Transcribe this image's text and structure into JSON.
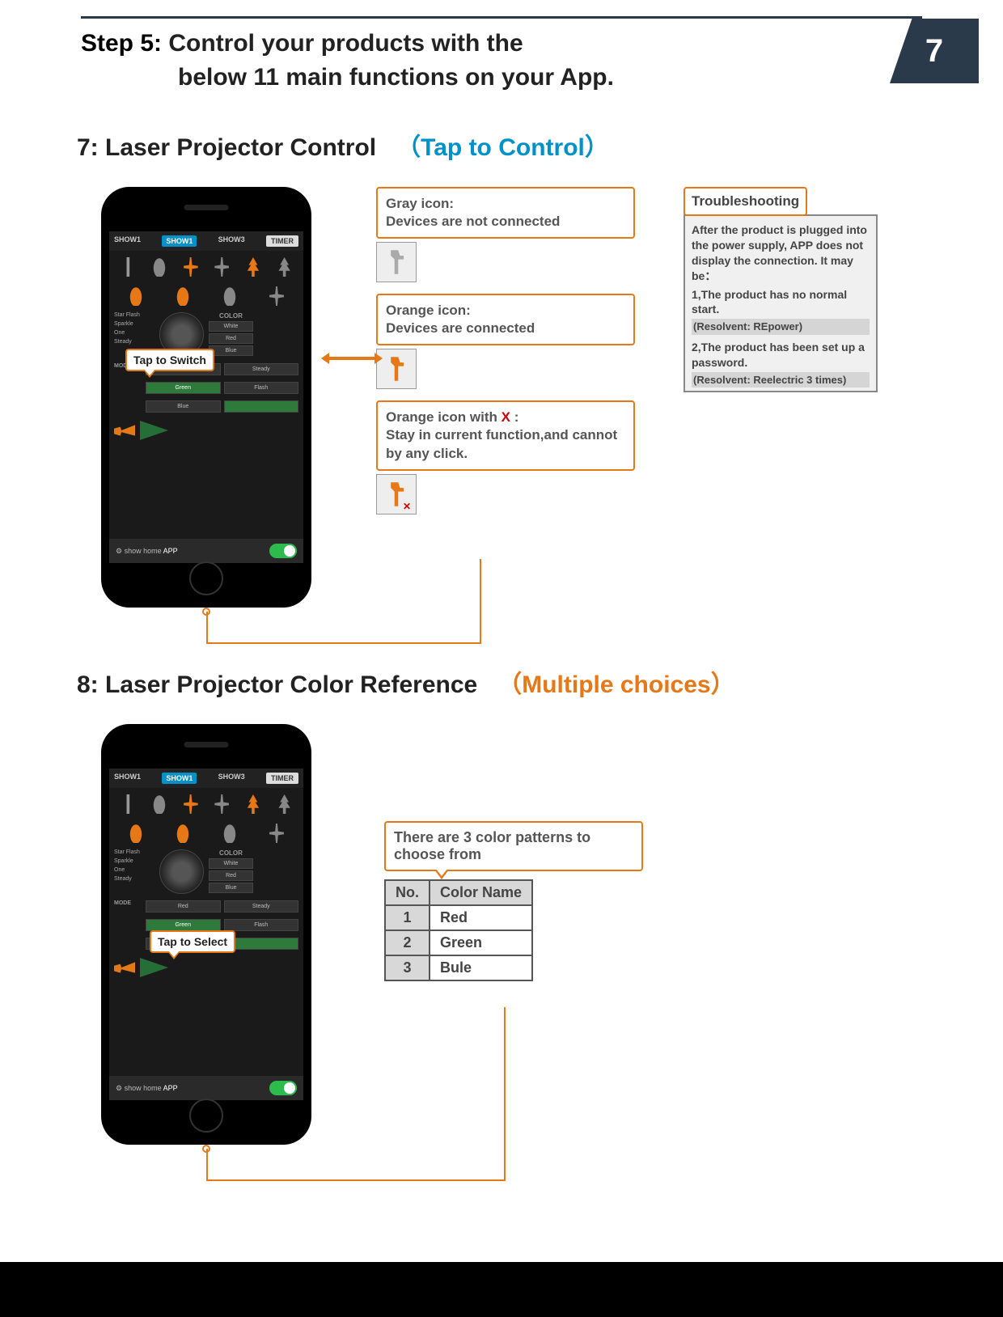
{
  "header": {
    "step_label": "Step 5:",
    "step_text_line1": "Control your products with the",
    "step_text_line2": "below 11 main functions on your App.",
    "page_number": "7"
  },
  "section7": {
    "prefix": "7:",
    "title": "Laser Projector Control",
    "paren_open": "（",
    "hint": "Tap to Control",
    "paren_close": "）",
    "speech": "Tap to Switch",
    "gray_box": "Gray icon:\nDevices are not connected",
    "orange_box": "Orange icon:\nDevices are connected",
    "orange_x_box_pre": "Orange icon with ",
    "orange_x_box_x": "X",
    "orange_x_box_post": " :\nStay in current function,and cannot by any click.",
    "trouble_title": "Troubleshooting",
    "trouble_intro": "After the product is plugged into the power supply, APP does not display the connection. It may be：",
    "trouble_1": "1,The product has no normal start.",
    "resolvent_1": "(Resolvent: REpower)",
    "trouble_2": "2,The product has been set up a password.",
    "resolvent_2": "(Resolvent: Reelectric 3 times)"
  },
  "section8": {
    "prefix": "8:",
    "title": "Laser Projector Color Reference",
    "paren_open": "（",
    "hint": "Multiple choices",
    "paren_close": "）",
    "speech": "Tap to Select",
    "table_hdr": "There are 3 color patterns to choose from",
    "col_no": "No.",
    "col_name": "Color Name",
    "rows": [
      {
        "no": "1",
        "name": "Red"
      },
      {
        "no": "2",
        "name": "Green"
      },
      {
        "no": "3",
        "name": "Bule"
      }
    ]
  },
  "phone": {
    "tab1": "SHOW1",
    "tab2": "SHOW1",
    "tab3": "SHOW3",
    "timer": "TIMER",
    "color_hdr": "COLOR",
    "c_white": "White",
    "c_red": "Red",
    "c_blue": "Blue",
    "mode_label": "MODE",
    "m_green": "Green",
    "m_steady": "Steady",
    "m_flash": "Flash",
    "brand": "show home",
    "app": "APP"
  }
}
